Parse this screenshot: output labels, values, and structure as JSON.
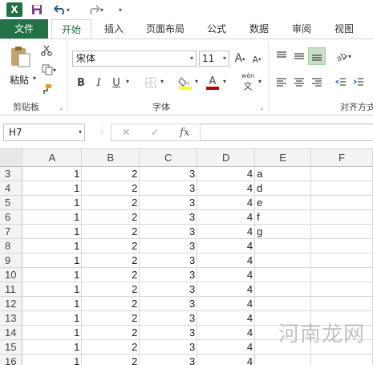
{
  "app": {
    "logo_text": "X"
  },
  "tabs": [
    "文件",
    "开始",
    "插入",
    "页面布局",
    "公式",
    "数据",
    "审阅",
    "视图"
  ],
  "ribbon": {
    "clipboard": {
      "paste_label": "粘贴",
      "group_label": "剪贴板"
    },
    "font": {
      "font_name": "宋体",
      "font_size": "11",
      "bold": "B",
      "italic": "I",
      "underline": "U",
      "grow": "A",
      "shrink": "A",
      "phonetic": "wén",
      "font_color_glyph": "A",
      "group_label": "字体"
    },
    "alignment": {
      "group_label": "对齐方式"
    }
  },
  "formula_bar": {
    "name_box": "H7",
    "fx_label": "fx",
    "cancel": "✕",
    "enter": "✓",
    "formula": ""
  },
  "grid": {
    "columns": [
      "A",
      "B",
      "C",
      "D",
      "E",
      "F"
    ],
    "rows": [
      {
        "num": "3",
        "cells": [
          "1",
          "2",
          "3",
          "4",
          "a",
          ""
        ]
      },
      {
        "num": "4",
        "cells": [
          "1",
          "2",
          "3",
          "4",
          "d",
          ""
        ]
      },
      {
        "num": "5",
        "cells": [
          "1",
          "2",
          "3",
          "4",
          "e",
          ""
        ]
      },
      {
        "num": "6",
        "cells": [
          "1",
          "2",
          "3",
          "4",
          "f",
          ""
        ]
      },
      {
        "num": "7",
        "cells": [
          "1",
          "2",
          "3",
          "4",
          "g",
          ""
        ]
      },
      {
        "num": "8",
        "cells": [
          "1",
          "2",
          "3",
          "4",
          "",
          ""
        ]
      },
      {
        "num": "9",
        "cells": [
          "1",
          "2",
          "3",
          "4",
          "",
          ""
        ]
      },
      {
        "num": "10",
        "cells": [
          "1",
          "2",
          "3",
          "4",
          "",
          ""
        ]
      },
      {
        "num": "11",
        "cells": [
          "1",
          "2",
          "3",
          "4",
          "",
          ""
        ]
      },
      {
        "num": "12",
        "cells": [
          "1",
          "2",
          "3",
          "4",
          "",
          ""
        ]
      },
      {
        "num": "13",
        "cells": [
          "1",
          "2",
          "3",
          "4",
          "",
          ""
        ]
      },
      {
        "num": "14",
        "cells": [
          "1",
          "2",
          "3",
          "4",
          "",
          ""
        ]
      },
      {
        "num": "15",
        "cells": [
          "1",
          "2",
          "3",
          "4",
          "",
          ""
        ]
      },
      {
        "num": "16",
        "cells": [
          "1",
          "2",
          "3",
          "4",
          "",
          ""
        ]
      }
    ]
  },
  "watermark": "河南龙网",
  "colors": {
    "excel_green": "#217346",
    "highlight_yellow": "#ffff00",
    "font_red": "#c00000"
  }
}
